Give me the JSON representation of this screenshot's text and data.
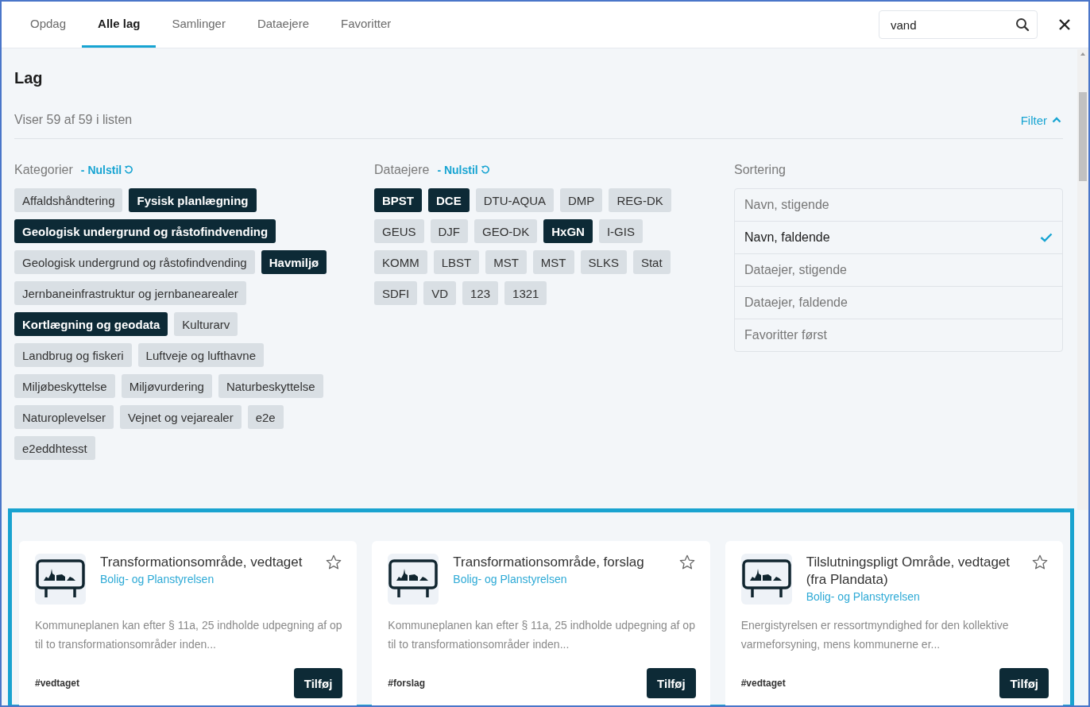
{
  "tabs": [
    {
      "label": "Opdag",
      "selected": false
    },
    {
      "label": "Alle lag",
      "selected": true
    },
    {
      "label": "Samlinger",
      "selected": false
    },
    {
      "label": "Dataejere",
      "selected": false
    },
    {
      "label": "Favoritter",
      "selected": false
    }
  ],
  "search": {
    "value": "vand"
  },
  "section": {
    "title": "Lag",
    "count": "Viser 59 af 59 i listen",
    "filter": {
      "label": "Filter",
      "expanded": true
    }
  },
  "categories": {
    "label": "Kategorier",
    "reset": "- Nulstil",
    "chips": [
      {
        "label": "Affaldshåndtering",
        "selected": false
      },
      {
        "label": "Fysisk planlægning",
        "selected": true
      },
      {
        "label": "Geologisk undergrund og råstofindvending",
        "selected": true
      },
      {
        "label": "Geologisk undergrund og råstofindvending",
        "selected": false
      },
      {
        "label": "Havmiljø",
        "selected": true
      },
      {
        "label": "Jernbaneinfrastruktur og jernbanearealer",
        "selected": false
      },
      {
        "label": "Kortlægning og geodata",
        "selected": true
      },
      {
        "label": "Kulturarv",
        "selected": false
      },
      {
        "label": "Landbrug og fiskeri",
        "selected": false
      },
      {
        "label": "Luftveje og lufthavne",
        "selected": false
      },
      {
        "label": "Miljøbeskyttelse",
        "selected": false
      },
      {
        "label": "Miljøvurdering",
        "selected": false
      },
      {
        "label": "Naturbeskyttelse",
        "selected": false
      },
      {
        "label": "Naturoplevelser",
        "selected": false
      },
      {
        "label": "Vejnet og vejarealer",
        "selected": false
      },
      {
        "label": "e2e",
        "selected": false
      },
      {
        "label": "e2eddhtesst",
        "selected": false
      }
    ]
  },
  "data_owners": {
    "label": "Dataejere",
    "reset": "- Nulstil",
    "chips": [
      {
        "label": "BPST",
        "selected": true
      },
      {
        "label": "DCE",
        "selected": true
      },
      {
        "label": "DTU-AQUA",
        "selected": false
      },
      {
        "label": "DMP",
        "selected": false
      },
      {
        "label": "REG-DK",
        "selected": false
      },
      {
        "label": "GEUS",
        "selected": false
      },
      {
        "label": "DJF",
        "selected": false
      },
      {
        "label": "GEO-DK",
        "selected": false
      },
      {
        "label": "HxGN",
        "selected": true
      },
      {
        "label": "I-GIS",
        "selected": false
      },
      {
        "label": "KOMM",
        "selected": false
      },
      {
        "label": "LBST",
        "selected": false
      },
      {
        "label": "MST",
        "selected": false
      },
      {
        "label": "MST",
        "selected": false
      },
      {
        "label": "SLKS",
        "selected": false
      },
      {
        "label": "Stat",
        "selected": false
      },
      {
        "label": "SDFI",
        "selected": false
      },
      {
        "label": "VD",
        "selected": false
      },
      {
        "label": "123",
        "selected": false
      },
      {
        "label": "1321",
        "selected": false
      }
    ]
  },
  "sorting": {
    "label": "Sortering",
    "options": [
      {
        "label": "Navn, stigende",
        "selected": false
      },
      {
        "label": "Navn, faldende",
        "selected": true
      },
      {
        "label": "Dataejer, stigende",
        "selected": false
      },
      {
        "label": "Dataejer, faldende",
        "selected": false
      },
      {
        "label": "Favoritter først",
        "selected": false
      }
    ]
  },
  "cards": [
    {
      "title": "Transformationsområde, vedtaget",
      "owner": "Bolig- og Planstyrelsen",
      "description": "Kommuneplanen kan efter § 11a, 25 indholde udpegning af op til to transformationsområder inden...",
      "tag": "#vedtaget",
      "button": "Tilføj",
      "favorite": false
    },
    {
      "title": "Transformationsområde, forslag",
      "owner": "Bolig- og Planstyrelsen",
      "description": "Kommuneplanen kan efter § 11a, 25 indholde udpegning af op til to transformationsområder inden...",
      "tag": "#forslag",
      "button": "Tilføj",
      "favorite": false
    },
    {
      "title": "Tilslutningspligt Område, vedtaget (fra Plandata)",
      "owner": "Bolig- og Planstyrelsen",
      "description": "Energistyrelsen er ressortmyndighed for den kollektive varmeforsyning, mens kommunerne er...",
      "tag": "#vedtaget",
      "button": "Tilføj",
      "favorite": false
    }
  ]
}
